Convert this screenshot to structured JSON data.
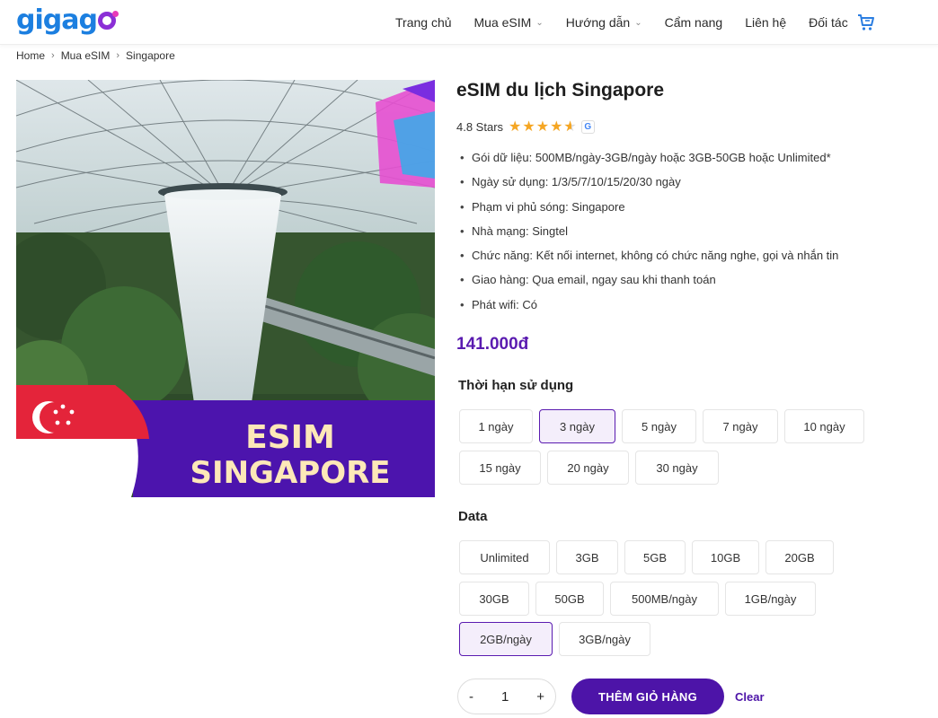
{
  "brand": {
    "logo_text": "gigago",
    "accent": "#4d14a8",
    "logo_blue": "#1c7fe0",
    "logo_purple": "#8b2fd6"
  },
  "nav": {
    "items": [
      {
        "label": "Trang chủ",
        "dropdown": false
      },
      {
        "label": "Mua eSIM",
        "dropdown": true
      },
      {
        "label": "Hướng dẫn",
        "dropdown": true
      },
      {
        "label": "Cẩm nang",
        "dropdown": false
      },
      {
        "label": "Liên hệ",
        "dropdown": false
      },
      {
        "label": "Đối tác",
        "dropdown": false
      }
    ],
    "cart_icon": "cart-icon"
  },
  "breadcrumb": [
    "Home",
    "Mua eSIM",
    "Singapore"
  ],
  "hero": {
    "line1": "ESIM",
    "line2": "SINGAPORE"
  },
  "product": {
    "title": "eSIM du lịch Singapore",
    "rating_text": "4.8 Stars",
    "rating_value": 4.8,
    "features": [
      "Gói dữ liệu: 500MB/ngày-3GB/ngày hoặc 3GB-50GB hoặc Unlimited*",
      "Ngày sử dụng: 1/3/5/7/10/15/20/30 ngày",
      "Phạm vi phủ sóng: Singapore",
      "Nhà mạng: Singtel",
      "Chức năng: Kết nối internet, không có chức năng nghe, gọi và nhắn tin",
      "Giao hàng: Qua email, ngay sau khi thanh toán",
      "Phát wifi: Có"
    ],
    "price": "141.000đ"
  },
  "duration": {
    "label": "Thời hạn sử dụng",
    "options": [
      "1 ngày",
      "3 ngày",
      "5 ngày",
      "7 ngày",
      "10 ngày",
      "15 ngày",
      "20 ngày",
      "30 ngày"
    ],
    "selected": "3 ngày"
  },
  "data_plan": {
    "label": "Data",
    "options": [
      "Unlimited",
      "3GB",
      "5GB",
      "10GB",
      "20GB",
      "30GB",
      "50GB",
      "500MB/ngày",
      "1GB/ngày",
      "2GB/ngày",
      "3GB/ngày"
    ],
    "selected": "2GB/ngày"
  },
  "cart": {
    "quantity": "1",
    "minus": "-",
    "plus": "+",
    "add_label": "THÊM GIỎ HÀNG",
    "clear_label": "Clear"
  }
}
